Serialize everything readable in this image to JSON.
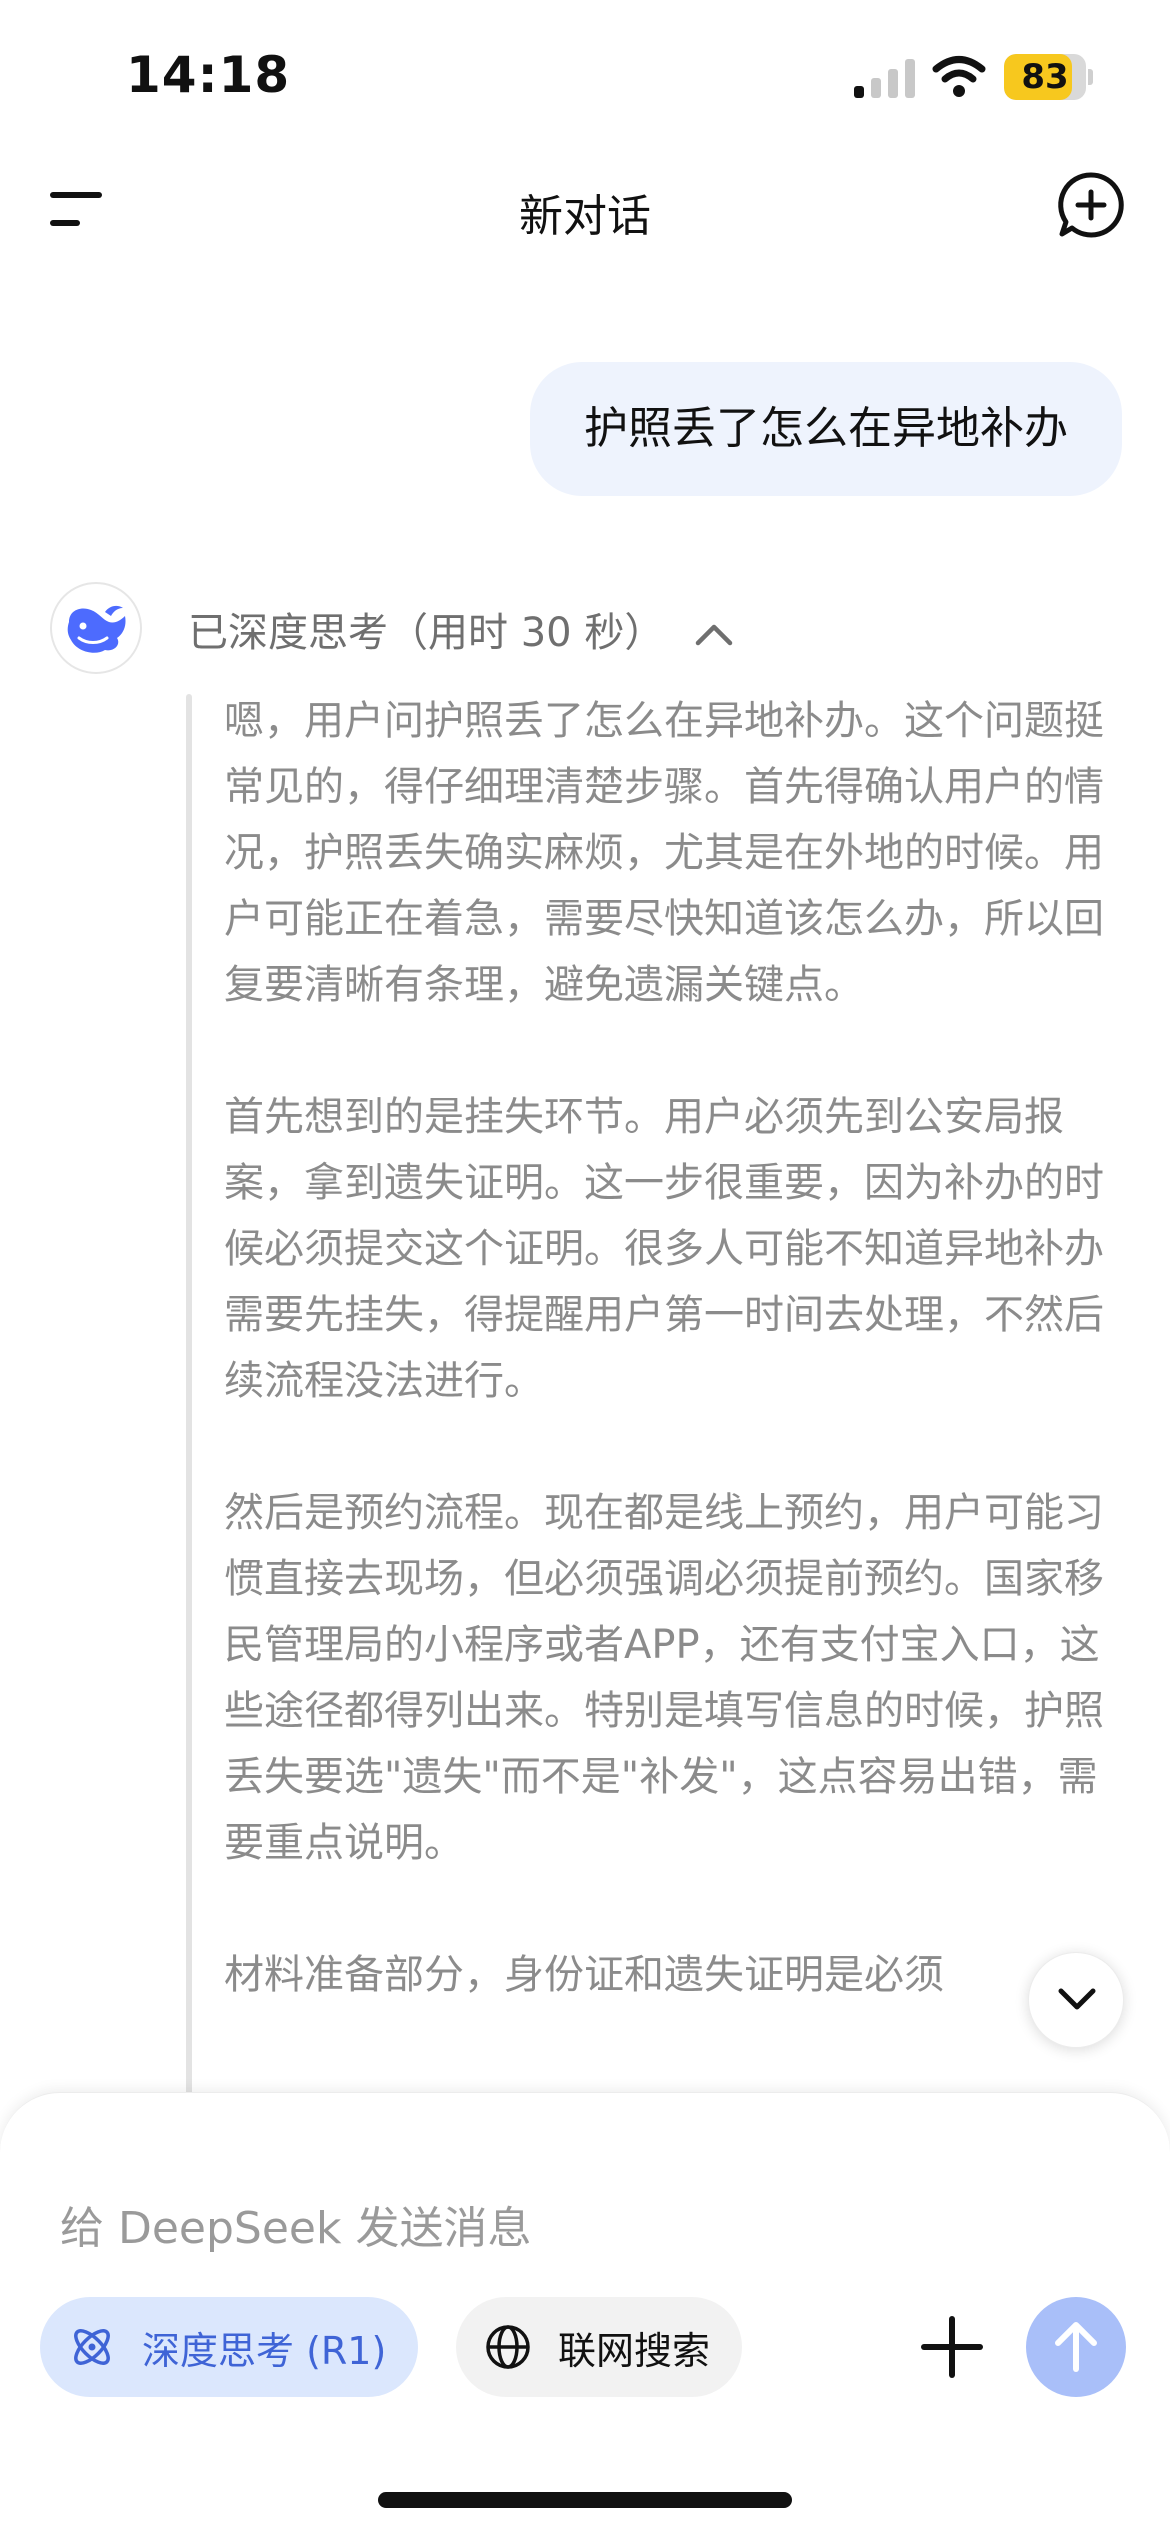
{
  "status_bar": {
    "time": "14:18",
    "battery": "83",
    "battery_level_percent": 83,
    "battery_color": "#f7c81e",
    "icons": [
      "signal-icon",
      "wifi-icon",
      "battery-icon"
    ]
  },
  "header": {
    "title": "新对话",
    "menu_icon": "menu-icon",
    "new_chat_icon": "new-chat-icon"
  },
  "conversation": {
    "user_message": "护照丢了怎么在异地补办",
    "assistant": {
      "avatar_icon": "deepseek-whale-icon",
      "think_header": "已深度思考（用时 30 秒）",
      "think_paragraphs": [
        "嗯，用户问护照丢了怎么在异地补办。这个问题挺常见的，得仔细理清楚步骤。首先得确认用户的情况，护照丢失确实麻烦，尤其是在外地的时候。用户可能正在着急，需要尽快知道该怎么办，所以回复要清晰有条理，避免遗漏关键点。",
        "首先想到的是挂失环节。用户必须先到公安局报案，拿到遗失证明。这一步很重要，因为补办的时候必须提交这个证明。很多人可能不知道异地补办需要先挂失，得提醒用户第一时间去处理，不然后续流程没法进行。",
        "然后是预约流程。现在都是线上预约，用户可能习惯直接去现场，但必须强调必须提前预约。国家移民管理局的小程序或者APP，还有支付宝入口，这些途径都得列出来。特别是填写信息的时候，护照丢失要选\"遗失\"而不是\"补发\"，这点容易出错，需要重点说明。",
        "材料准备部分，身份证和遗失证明是必须"
      ]
    }
  },
  "composer": {
    "placeholder": "给 DeepSeek 发送消息",
    "deep_think_label": "深度思考 (R1)",
    "web_search_label": "联网搜索",
    "accent_color": "#3f64d6",
    "deep_think_bg": "#dbe7fd",
    "send_button_color": "#a9bff9"
  }
}
